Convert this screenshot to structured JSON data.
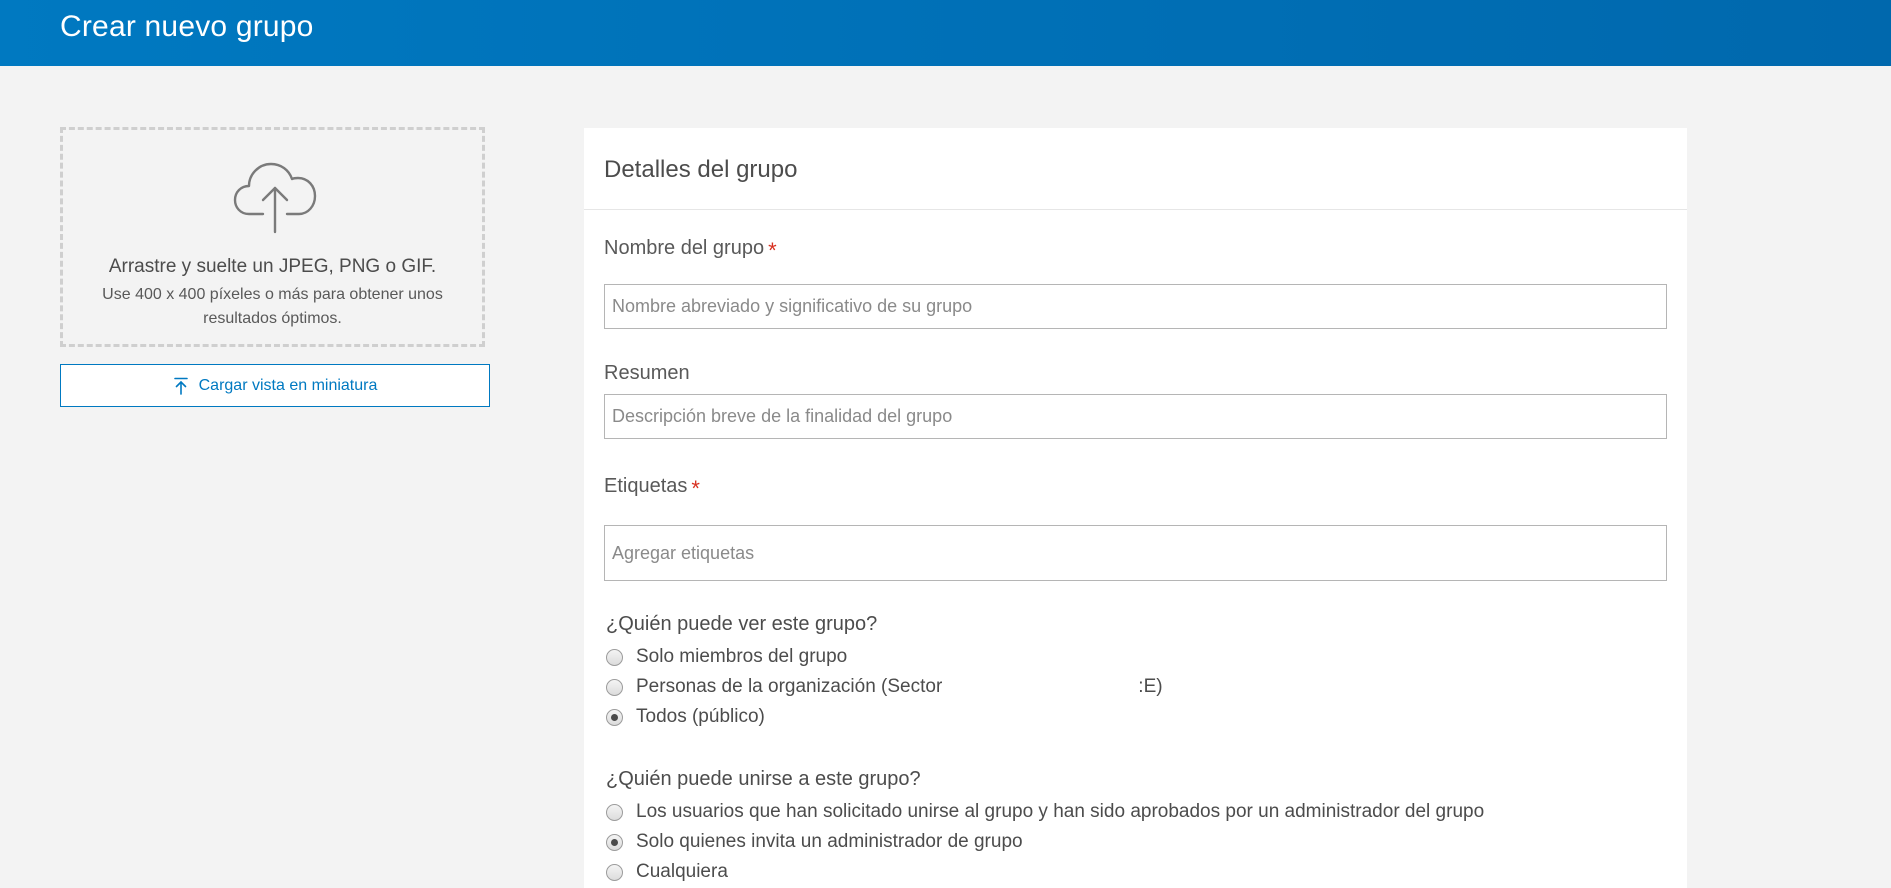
{
  "header": {
    "title": "Crear nuevo grupo"
  },
  "thumbnail": {
    "drop_title": "Arrastre y suelte un JPEG, PNG o GIF.",
    "drop_hint": "Use 400 x 400 píxeles o más para obtener unos resultados óptimos.",
    "upload_label": "Cargar vista en miniatura",
    "icon": "cloud-upload-icon"
  },
  "panel": {
    "title": "Detalles del grupo",
    "name": {
      "label": "Nombre del grupo",
      "required_mark": "*",
      "placeholder": "Nombre abreviado y significativo de su grupo",
      "value": ""
    },
    "summary": {
      "label": "Resumen",
      "placeholder": "Descripción breve de la finalidad del grupo",
      "value": ""
    },
    "tags": {
      "label": "Etiquetas",
      "required_mark": "*",
      "placeholder": "Agregar etiquetas",
      "value": ""
    },
    "visibility": {
      "question": "¿Quién puede ver este grupo?",
      "options": [
        {
          "label": "Solo miembros del grupo",
          "checked": false
        },
        {
          "label": "Personas de la organización (Sector",
          "suffix": ":E)",
          "checked": false
        },
        {
          "label": "Todos (público)",
          "checked": true
        }
      ]
    },
    "membership": {
      "question": "¿Quién puede unirse a este grupo?",
      "options": [
        {
          "label": "Los usuarios que han solicitado unirse al grupo y han sido aprobados por un administrador del grupo",
          "checked": false
        },
        {
          "label": "Solo quienes invita un administrador de grupo",
          "checked": true
        },
        {
          "label": "Cualquiera",
          "checked": false
        }
      ]
    }
  },
  "colors": {
    "header": "#0079c1",
    "accent": "#0079c1",
    "required": "#d83020",
    "background": "#f3f3f3"
  }
}
